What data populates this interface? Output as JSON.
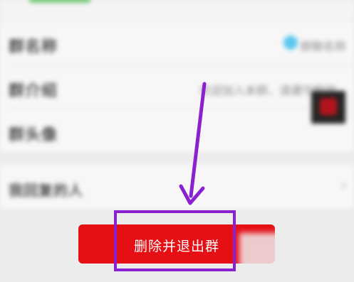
{
  "settings": {
    "rows": [
      {
        "label": "群名称",
        "value": "群聊名称"
      },
      {
        "label": "群介绍",
        "value": "欢迎加入本群，请遵守群规"
      },
      {
        "label": "群头像",
        "value": ""
      }
    ],
    "reply_row": {
      "label": "我回复的人",
      "chevron": "›"
    }
  },
  "actions": {
    "delete_and_exit_label": "删除并退出群"
  },
  "annotation": {
    "color": "#8a21d1",
    "arrow_icon": "down-arrow-icon"
  },
  "colors": {
    "danger": "#e50f14",
    "toggle": "#5cc6ee"
  }
}
